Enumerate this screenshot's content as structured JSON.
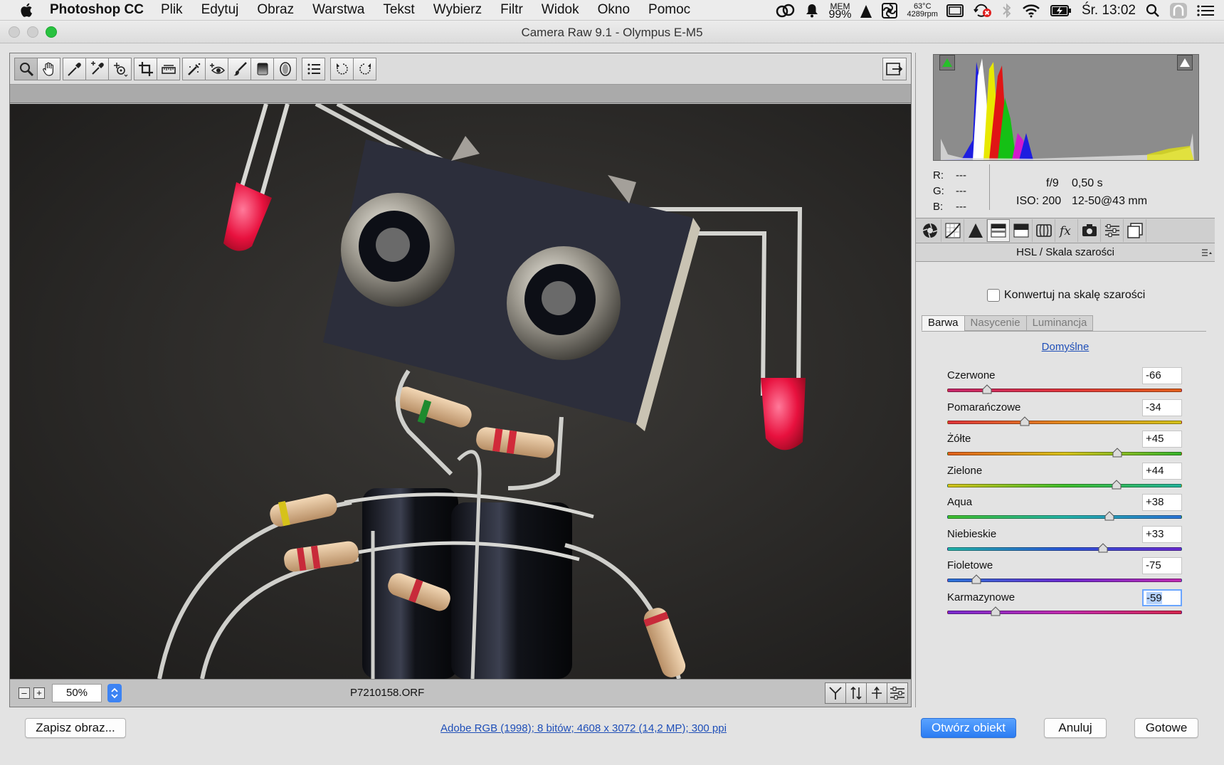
{
  "menubar": {
    "app_name": "Photoshop CC",
    "items": [
      "Plik",
      "Edytuj",
      "Obraz",
      "Warstwa",
      "Tekst",
      "Wybierz",
      "Filtr",
      "Widok",
      "Okno",
      "Pomoc"
    ],
    "mem_label": "MEM",
    "mem_value": "99%",
    "temp": "63°C",
    "fan": "4289rpm",
    "clock": "Śr. 13:02"
  },
  "window": {
    "title": "Camera Raw 9.1  -  Olympus E-M5"
  },
  "toolbar": {
    "tools": [
      "zoom-icon",
      "hand-icon",
      "white-balance-icon",
      "color-sampler-icon",
      "targeted-adjustment-icon",
      "crop-icon",
      "straighten-icon",
      "spot-removal-icon",
      "red-eye-icon",
      "adjustment-brush-icon",
      "graduated-filter-icon",
      "radial-filter-icon",
      "preferences-icon",
      "rotate-left-icon",
      "rotate-right-icon"
    ],
    "active_tool": "zoom-icon"
  },
  "preview": {
    "zoom": "50%",
    "filename": "P7210158.ORF"
  },
  "info": {
    "r_label": "R:",
    "r_value": "---",
    "g_label": "G:",
    "g_value": "---",
    "b_label": "B:",
    "b_value": "---",
    "aperture": "f/9",
    "shutter": "0,50 s",
    "iso": "ISO: 200",
    "lens": "12-50@43 mm"
  },
  "panel": {
    "title": "HSL / Skala szarości",
    "convert_label": "Konwertuj na skalę szarości",
    "tabs": [
      "Barwa",
      "Nasycenie",
      "Luminancja"
    ],
    "active_tab": "Barwa",
    "defaults_label": "Domyślne",
    "sliders": [
      {
        "label": "Czerwone",
        "value": "-66",
        "num": -66,
        "gradient": [
          "#c6266b",
          "#e0343a",
          "#e2601c"
        ]
      },
      {
        "label": "Pomarańczowe",
        "value": "-34",
        "num": -34,
        "gradient": [
          "#e0343a",
          "#e2891c",
          "#d4c21a"
        ]
      },
      {
        "label": "Żółte",
        "value": "+45",
        "num": 45,
        "gradient": [
          "#e2601c",
          "#d8c21a",
          "#35b52c"
        ]
      },
      {
        "label": "Zielone",
        "value": "+44",
        "num": 44,
        "gradient": [
          "#d4c21a",
          "#3fbf2c",
          "#22b39b"
        ]
      },
      {
        "label": "Aqua",
        "value": "+38",
        "num": 38,
        "gradient": [
          "#3fbf2c",
          "#22b3a6",
          "#2a74d8"
        ]
      },
      {
        "label": "Niebieskie",
        "value": "+33",
        "num": 33,
        "gradient": [
          "#22b3a6",
          "#2a56d8",
          "#6a2ad0"
        ]
      },
      {
        "label": "Fioletowe",
        "value": "-75",
        "num": -75,
        "gradient": [
          "#2a74d8",
          "#6a2ad0",
          "#c02ab0"
        ]
      },
      {
        "label": "Karmazynowe",
        "value": "-59",
        "num": -59,
        "gradient": [
          "#7a2ad0",
          "#c12aae",
          "#d5264e"
        ]
      }
    ]
  },
  "footer": {
    "save_label": "Zapisz obraz...",
    "color_info": "Adobe RGB (1998); 8 bitów; 4608 x 3072 (14,2 MP); 300 ppi",
    "open_label": "Otwórz obiekt",
    "cancel_label": "Anuluj",
    "done_label": "Gotowe"
  }
}
